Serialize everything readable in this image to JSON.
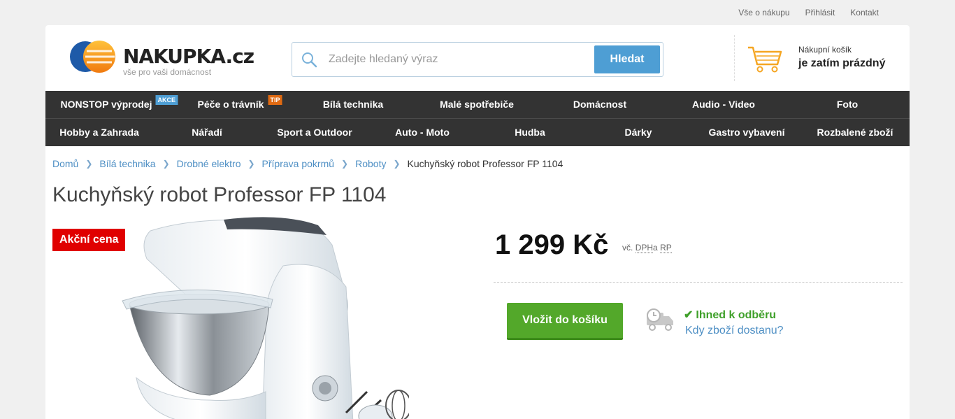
{
  "top_links": [
    "Vše o nákupu",
    "Přihlásit",
    "Kontakt"
  ],
  "logo": {
    "name": "NAKUPKA.cz",
    "tagline": "vše pro vaši domácnost"
  },
  "search": {
    "placeholder": "Zadejte hledaný výraz",
    "button_label": "Hledat"
  },
  "cart": {
    "label": "Nákupní košík",
    "status": "je zatím prázdný"
  },
  "nav": {
    "row1": [
      {
        "label": "NONSTOP výprodej",
        "badge": "AKCE"
      },
      {
        "label": "Péče o trávník",
        "badge": "TIP"
      },
      {
        "label": "Bílá technika"
      },
      {
        "label": "Malé spotřebiče"
      },
      {
        "label": "Domácnost"
      },
      {
        "label": "Audio - Video"
      },
      {
        "label": "Foto"
      }
    ],
    "row2": [
      {
        "label": "Hobby a Zahrada"
      },
      {
        "label": "Nářadí"
      },
      {
        "label": "Sport a Outdoor"
      },
      {
        "label": "Auto - Moto"
      },
      {
        "label": "Hudba"
      },
      {
        "label": "Dárky"
      },
      {
        "label": "Gastro vybavení"
      },
      {
        "label": "Rozbalené zboží"
      }
    ]
  },
  "breadcrumb": {
    "links": [
      "Domů",
      "Bílá technika",
      "Drobné elektro",
      "Příprava pokrmů",
      "Roboty"
    ],
    "current": "Kuchyňský robot Professor FP 1104"
  },
  "product": {
    "title": "Kuchyňský robot Professor FP 1104",
    "promo_label": "Akční cena",
    "price": "1 299 Kč",
    "vat_prefix": "vč.",
    "vat_dph": "DPH",
    "vat_a": "a",
    "vat_rp": "RP",
    "add_to_cart": "Vložit do košíku",
    "stock_status": "Ihned k odběru",
    "delivery_link": "Kdy zboží dostanu?"
  },
  "colors": {
    "accent_blue": "#4e9ed4",
    "nav_bg": "#333333",
    "promo_red": "#e00000",
    "cta_green": "#53a82a",
    "stock_green": "#3fa02a",
    "badge_tip": "#e06a12"
  }
}
